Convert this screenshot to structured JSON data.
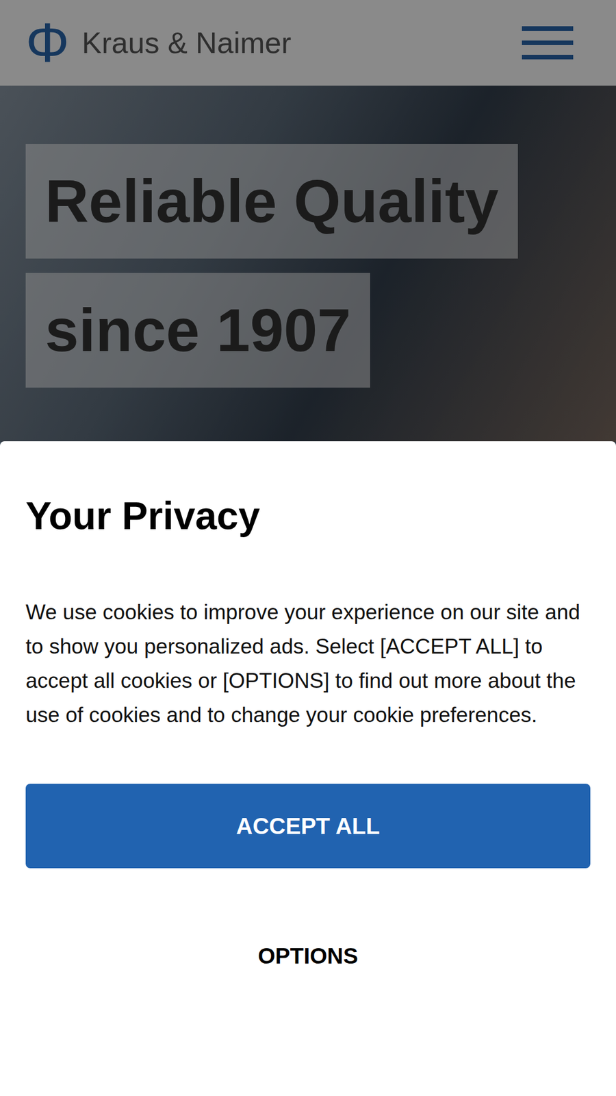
{
  "header": {
    "logo_symbol": "Φ",
    "brand": "Kraus & Naimer"
  },
  "hero": {
    "lines": [
      "Reliable Quality",
      "since 1907"
    ]
  },
  "privacy": {
    "title": "Your Privacy",
    "text": "We use cookies to improve your experience on our site and to show you personalized ads. Select [ACCEPT ALL] to accept all cookies or [OPTIONS] to find out more about the use of cookies and to change your cookie preferences.",
    "buttons": [
      {
        "label": "ACCEPT ALL",
        "kind": "primary"
      },
      {
        "label": "OPTIONS",
        "kind": "text"
      }
    ]
  }
}
